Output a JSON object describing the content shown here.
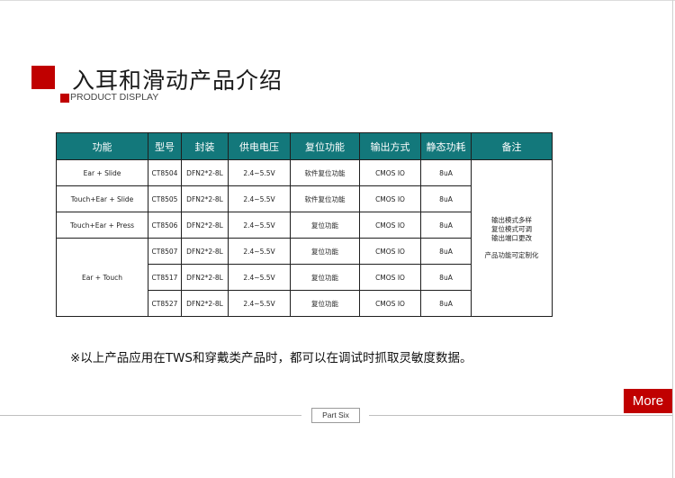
{
  "header": {
    "title": "入耳和滑动产品介绍",
    "subtitle": "PRODUCT DISPLAY"
  },
  "table": {
    "headers": [
      "功能",
      "型号",
      "封装",
      "供电电压",
      "复位功能",
      "输出方式",
      "静态功耗",
      "备注"
    ],
    "groups": {
      "g1": "Ear + Slide",
      "g2": "Touch+Ear + Slide",
      "g3": "Touch+Ear + Press",
      "g4": "Ear + Touch"
    },
    "rows": [
      {
        "model": "CT8504",
        "package": "DFN2*2-8L",
        "voltage": "2.4~5.5V",
        "reset": "软件复位功能",
        "output": "CMOS IO",
        "power": "8uA"
      },
      {
        "model": "CT8505",
        "package": "DFN2*2-8L",
        "voltage": "2.4~5.5V",
        "reset": "软件复位功能",
        "output": "CMOS IO",
        "power": "8uA"
      },
      {
        "model": "CT8506",
        "package": "DFN2*2-8L",
        "voltage": "2.4~5.5V",
        "reset": "复位功能",
        "output": "CMOS IO",
        "power": "8uA"
      },
      {
        "model": "CT8507",
        "package": "DFN2*2-8L",
        "voltage": "2.4~5.5V",
        "reset": "复位功能",
        "output": "CMOS IO",
        "power": "8uA"
      },
      {
        "model": "CT8517",
        "package": "DFN2*2-8L",
        "voltage": "2.4~5.5V",
        "reset": "复位功能",
        "output": "CMOS IO",
        "power": "8uA"
      },
      {
        "model": "CT8527",
        "package": "DFN2*2-8L",
        "voltage": "2.4~5.5V",
        "reset": "复位功能",
        "output": "CMOS IO",
        "power": "8uA"
      }
    ],
    "notes": [
      "输出模式多样",
      "复位模式可调",
      "输出端口更改",
      "产品功能可定制化"
    ]
  },
  "footnote": "※以上产品应用在TWS和穿戴类产品时，都可以在调试时抓取灵敏度数据。",
  "more_button": "More",
  "part_label": "Part Six",
  "colors": {
    "accent": "#c00000",
    "header_teal": "#13787b"
  }
}
